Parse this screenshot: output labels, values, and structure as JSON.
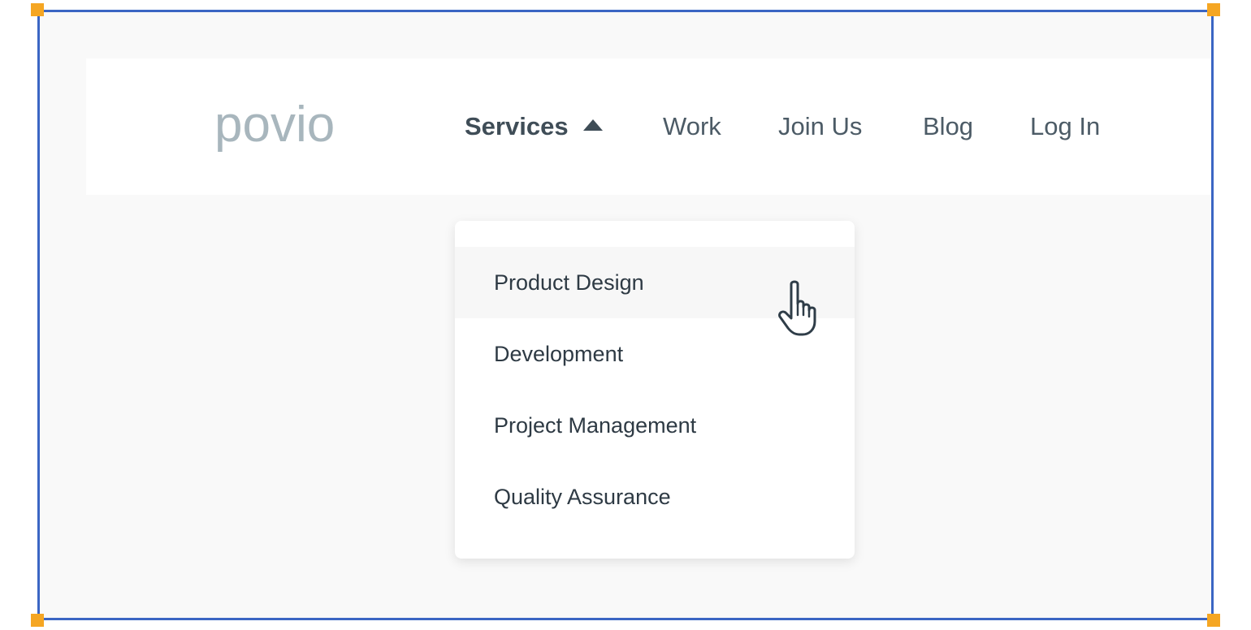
{
  "brand": {
    "logo_text": "povio",
    "logo_color": "#a8b6bd"
  },
  "nav": {
    "items": [
      {
        "label": "Services",
        "expanded": true
      },
      {
        "label": "Work"
      },
      {
        "label": "Join Us"
      },
      {
        "label": "Blog"
      },
      {
        "label": "Log In"
      }
    ]
  },
  "dropdown": {
    "items": [
      {
        "label": "Product Design",
        "hovered": true
      },
      {
        "label": "Development"
      },
      {
        "label": "Project Management"
      },
      {
        "label": "Quality Assurance"
      }
    ]
  },
  "colors": {
    "frame": "#3b66c4",
    "handles": "#f5a623",
    "text_dark": "#3f4d57"
  },
  "icons": {
    "caret": "caret-up-icon",
    "cursor": "hand-pointer-icon"
  }
}
